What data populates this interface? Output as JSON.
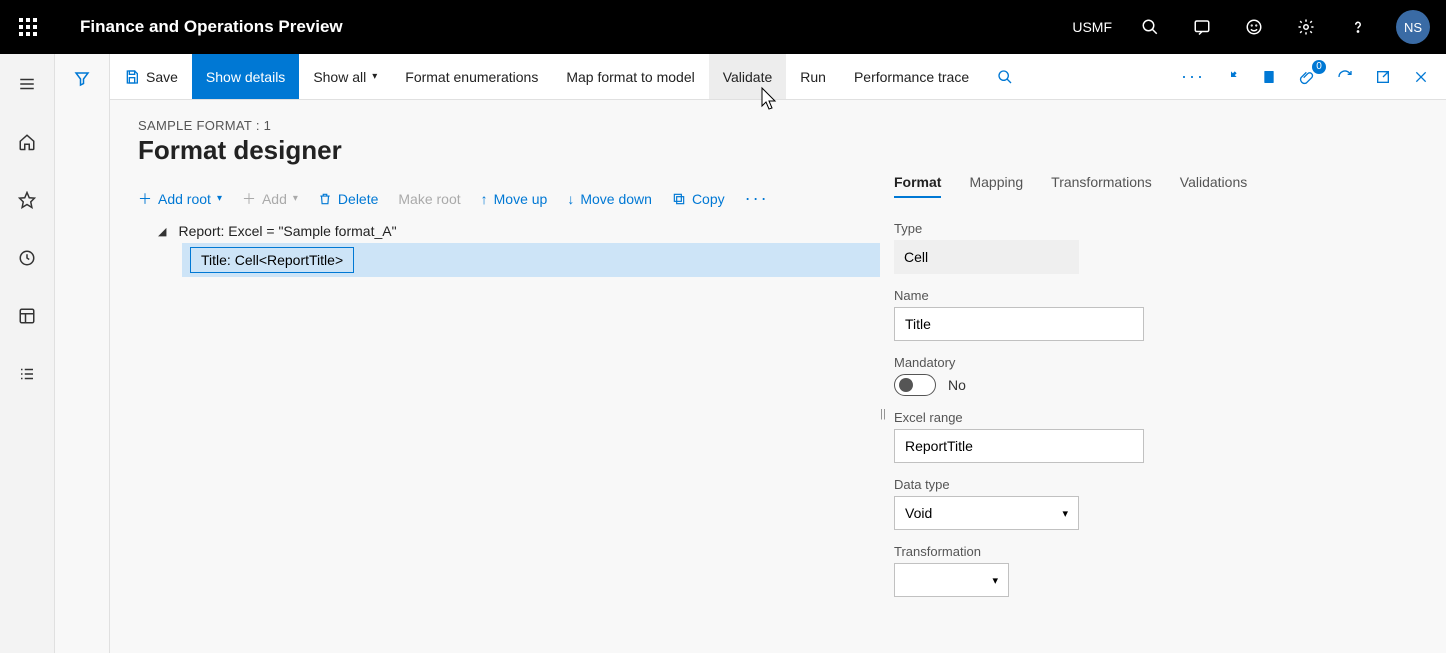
{
  "header": {
    "app_title": "Finance and Operations Preview",
    "org": "USMF",
    "avatar_initials": "NS"
  },
  "cmdbar": {
    "save": "Save",
    "show_details": "Show details",
    "show_all": "Show all",
    "format_enum": "Format enumerations",
    "map_format": "Map format to model",
    "validate": "Validate",
    "run": "Run",
    "perf_trace": "Performance trace",
    "badge": "0"
  },
  "page": {
    "breadcrumb": "SAMPLE FORMAT : 1",
    "title": "Format designer"
  },
  "toolbar": {
    "add_root": "Add root",
    "add": "Add",
    "delete": "Delete",
    "make_root": "Make root",
    "move_up": "Move up",
    "move_down": "Move down",
    "copy": "Copy"
  },
  "tree": {
    "root": "Report: Excel = \"Sample format_A\"",
    "child": "Title: Cell<ReportTitle>"
  },
  "tabs": {
    "format": "Format",
    "mapping": "Mapping",
    "transformations": "Transformations",
    "validations": "Validations"
  },
  "props": {
    "type_label": "Type",
    "type_value": "Cell",
    "name_label": "Name",
    "name_value": "Title",
    "mandatory_label": "Mandatory",
    "mandatory_value": "No",
    "excel_range_label": "Excel range",
    "excel_range_value": "ReportTitle",
    "data_type_label": "Data type",
    "data_type_value": "Void",
    "transformation_label": "Transformation",
    "transformation_value": ""
  }
}
